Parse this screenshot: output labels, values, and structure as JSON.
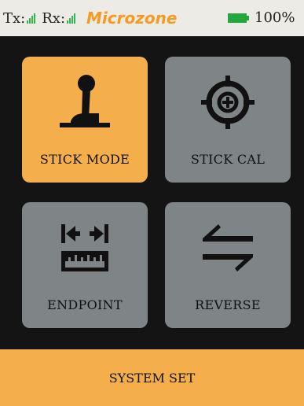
{
  "status": {
    "tx_label": "Tx:",
    "rx_label": "Rx:",
    "brand": "Microzone",
    "battery_text": "100%",
    "battery_level": 1.0
  },
  "menu": {
    "tiles": [
      {
        "label": "STICK MODE",
        "icon": "joystick-icon",
        "selected": true
      },
      {
        "label": "STICK CAL",
        "icon": "crosshair-icon",
        "selected": false
      },
      {
        "label": "ENDPOINT",
        "icon": "endpoint-ruler-icon",
        "selected": false
      },
      {
        "label": "REVERSE",
        "icon": "reverse-arrows-icon",
        "selected": false
      }
    ]
  },
  "footer": {
    "title": "SYSTEM SET"
  },
  "colors": {
    "accent": "#f4ae4c",
    "tile": "#7f8486",
    "signal": "#33b64a",
    "brand": "#f49b22"
  }
}
